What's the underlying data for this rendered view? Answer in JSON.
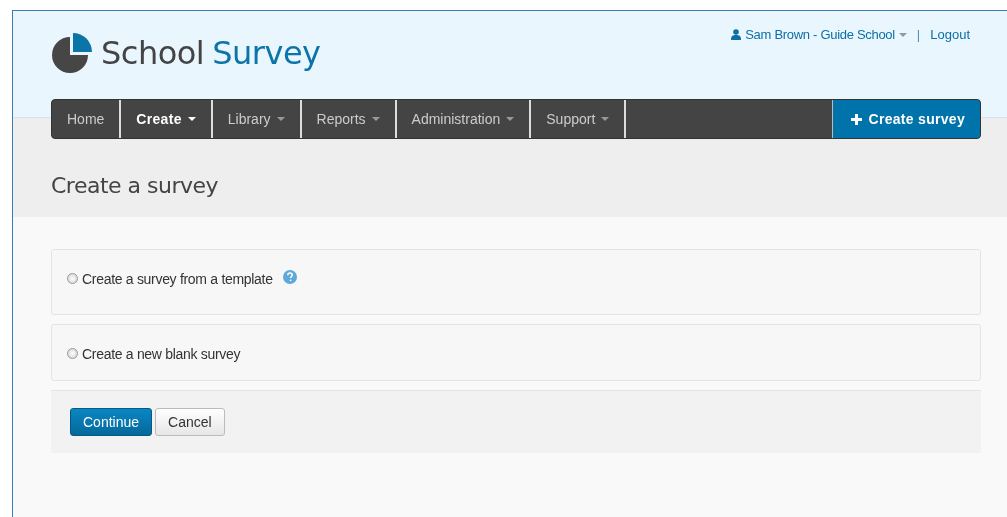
{
  "header": {
    "logo": {
      "word_1": "School",
      "word_2": "Survey"
    },
    "user_menu": {
      "label": "Sam Brown - Guide School"
    },
    "separator": "|",
    "logout": "Logout"
  },
  "nav": {
    "items": [
      {
        "label": "Home",
        "selected": false,
        "dropdown": false
      },
      {
        "label": "Create",
        "selected": true,
        "dropdown": true
      },
      {
        "label": "Library",
        "selected": false,
        "dropdown": true
      },
      {
        "label": "Reports",
        "selected": false,
        "dropdown": true
      },
      {
        "label": "Administration",
        "selected": false,
        "dropdown": true
      },
      {
        "label": "Support",
        "selected": false,
        "dropdown": true
      }
    ],
    "action": {
      "label": "Create survey"
    }
  },
  "page_title": "Create a survey",
  "options": [
    {
      "label": "Create a survey from a template",
      "selected": false,
      "help": true
    },
    {
      "label": "Create a new blank survey",
      "selected": false,
      "help": false
    }
  ],
  "buttons": [
    {
      "label": "Continue",
      "kind": "primary"
    },
    {
      "label": "Cancel",
      "kind": "default"
    }
  ]
}
